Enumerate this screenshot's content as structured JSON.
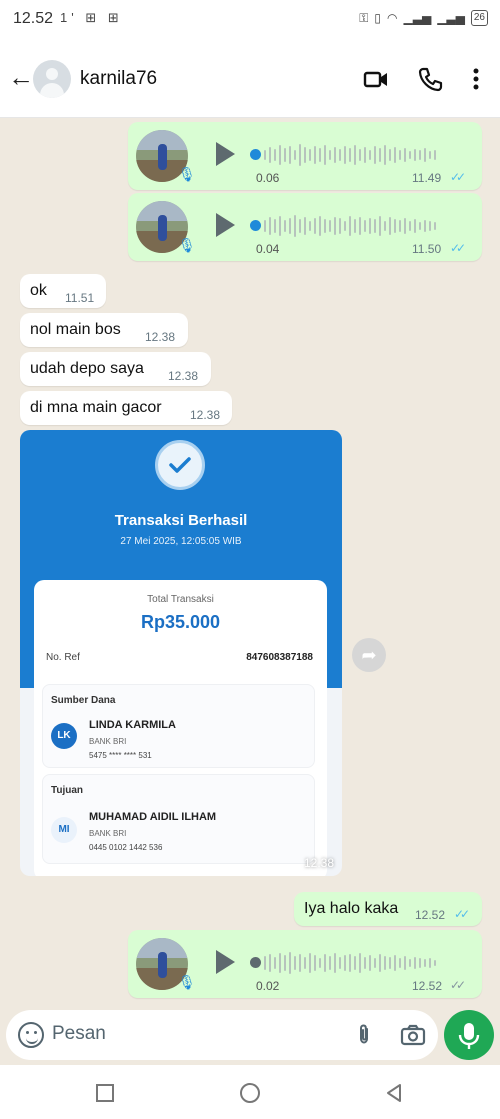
{
  "status_bar": {
    "time": "12.52",
    "left_icons": "1' ⊞ ⊞",
    "battery": "26"
  },
  "header": {
    "contact_name": "karnila76",
    "icons": [
      "back-arrow-icon",
      "video-call-icon",
      "phone-icon",
      "more-vert-icon"
    ]
  },
  "messages": [
    {
      "type": "voice",
      "direction": "out",
      "duration": "0.06",
      "time": "11.49",
      "ticks": "✓✓"
    },
    {
      "type": "voice",
      "direction": "out",
      "duration": "0.04",
      "time": "11.50",
      "ticks": "✓✓"
    },
    {
      "type": "text",
      "direction": "in",
      "text": "ok",
      "time": "11.51"
    },
    {
      "type": "text",
      "direction": "in",
      "text": "nol main bos",
      "time": "12.38"
    },
    {
      "type": "text",
      "direction": "in",
      "text": "udah depo saya",
      "time": "12.38"
    },
    {
      "type": "text",
      "direction": "in",
      "text": "di mna main gacor",
      "time": "12.38"
    },
    {
      "type": "text",
      "direction": "out",
      "text": "Iya halo kaka",
      "time": "12.52",
      "ticks": "✓✓"
    },
    {
      "type": "voice",
      "direction": "out",
      "duration": "0.02",
      "time": "12.52",
      "ticks": "✓✓"
    }
  ],
  "receipt": {
    "title": "Transaksi Berhasil",
    "date": "27 Mei 2025, 12:05:05 WIB",
    "total_label": "Total Transaksi",
    "amount": "Rp35.000",
    "ref_label": "No. Ref",
    "ref_value": "847608387188",
    "source": {
      "section_title": "Sumber Dana",
      "initials": "LK",
      "name": "LINDA KARMILA",
      "bank": "BANK BRI",
      "account": "5475 **** **** 531"
    },
    "destination": {
      "section_title": "Tujuan",
      "initials": "MI",
      "name": "MUHAMAD AIDIL ILHAM",
      "bank": "BANK BRI",
      "account": "0445 0102 1442 536"
    },
    "time": "12.38",
    "colors": {
      "header": "#1b7dd0",
      "amount": "#1b6fc4",
      "source_avatar": "#1b6fc4"
    }
  },
  "input": {
    "placeholder": "Pesan"
  },
  "colors": {
    "outgoing_bubble": "#d9fdd3",
    "incoming_bubble": "#ffffff",
    "read_ticks": "#53bdeb",
    "voice_dot": "#1f8ad9",
    "send_button": "#1fa855",
    "chat_background": "#efe9df"
  }
}
